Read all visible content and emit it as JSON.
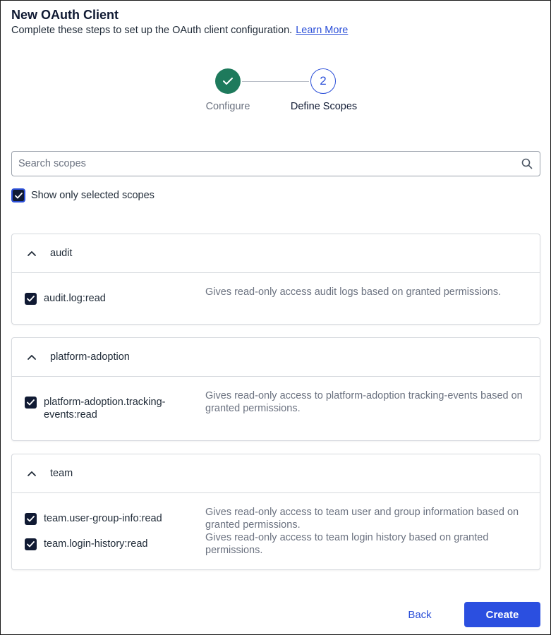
{
  "header": {
    "title": "New OAuth Client",
    "subtitle": "Complete these steps to set up the OAuth client configuration.",
    "learn_more": "Learn More"
  },
  "stepper": {
    "steps": [
      {
        "number": "1",
        "label": "Configure",
        "status": "complete"
      },
      {
        "number": "2",
        "label": "Define Scopes",
        "status": "current"
      }
    ]
  },
  "search": {
    "placeholder": "Search scopes",
    "value": ""
  },
  "filter": {
    "label": "Show only selected scopes",
    "checked": true
  },
  "groups": [
    {
      "name": "audit",
      "expanded": true,
      "scopes": [
        {
          "name": "audit.log:read",
          "checked": true,
          "description": "Gives read-only access audit logs based on granted permissions."
        }
      ]
    },
    {
      "name": "platform-adoption",
      "expanded": true,
      "scopes": [
        {
          "name": "platform-adoption.tracking-events:read",
          "checked": true,
          "description": "Gives read-only access to platform-adoption tracking-events based on granted permissions."
        }
      ]
    },
    {
      "name": "team",
      "expanded": true,
      "scopes": [
        {
          "name": "team.user-group-info:read",
          "checked": true,
          "description": "Gives read-only access to team user and group information based on granted permissions."
        },
        {
          "name": "team.login-history:read",
          "checked": true,
          "description": "Gives read-only access to team login history based on granted permissions."
        }
      ]
    }
  ],
  "footer": {
    "back_label": "Back",
    "create_label": "Create"
  },
  "colors": {
    "accent": "#2b4fd8",
    "success": "#1e7a5c",
    "checkbox": "#101a33"
  }
}
